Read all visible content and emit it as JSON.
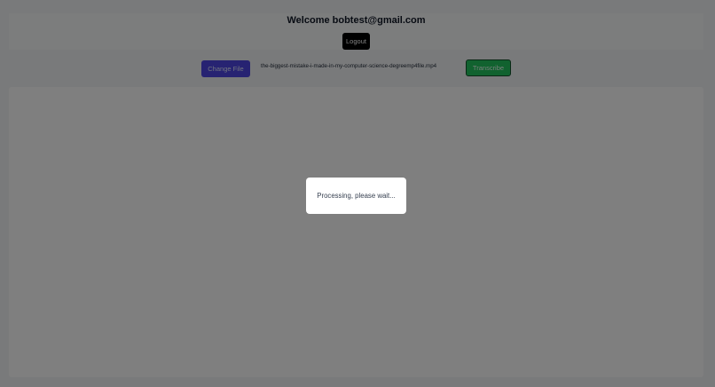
{
  "header": {
    "welcome_text": "Welcome bobtest@gmail.com",
    "logout_label": "Logout"
  },
  "file_controls": {
    "change_file_label": "Change File",
    "file_name": "the-biggest-mistake-i-made-in-my-computer-science-degreemp4file.mp4",
    "transcribe_label": "Transcribe"
  },
  "transcript": {
    "text": ""
  },
  "modal": {
    "message": "Processing, please wait..."
  },
  "colors": {
    "change_file_button": "#4f46e5",
    "transcribe_button": "#22c55e",
    "logout_button": "#000000",
    "overlay": "rgba(0,0,0,0.5)"
  }
}
